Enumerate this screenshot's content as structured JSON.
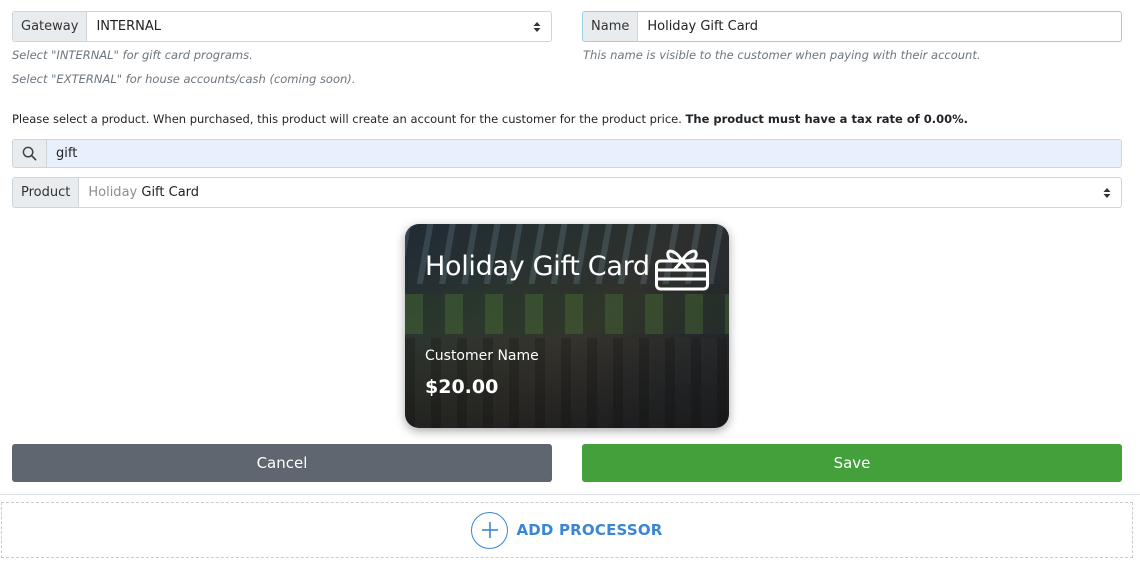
{
  "gateway": {
    "label": "Gateway",
    "value": "INTERNAL",
    "help_internal": "Select \"INTERNAL\" for gift card programs.",
    "help_external": "Select \"EXTERNAL\" for house accounts/cash (coming soon)."
  },
  "name": {
    "label": "Name",
    "value": "Holiday Gift Card",
    "help": "This name is visible to the customer when paying with their account."
  },
  "instructions": {
    "text": "Please select a product. When purchased, this product will create an account for the customer for the product price. ",
    "bold": "The product must have a tax rate of 0.00%."
  },
  "search": {
    "value": "gift",
    "icon": "search-icon"
  },
  "product": {
    "label": "Product",
    "value_prefix": "Holiday",
    "value_rest": " Gift Card"
  },
  "card": {
    "title": "Holiday Gift Card",
    "customer_name": "Customer Name",
    "amount": "$20.00",
    "icon": "gift-card-icon"
  },
  "actions": {
    "cancel": "Cancel",
    "save": "Save",
    "cancel_color": "#5f6670",
    "save_color": "#43a03b"
  },
  "add_processor": {
    "label": "ADD PROCESSOR",
    "icon": "plus-circle-icon",
    "color": "#3a86d4"
  }
}
